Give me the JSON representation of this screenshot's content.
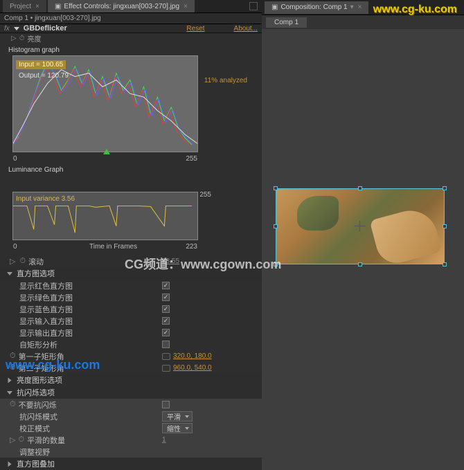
{
  "tabs": {
    "project": "Project",
    "effect_controls": "Effect Controls: jingxuan[003-270].jpg"
  },
  "breadcrumb": "Comp 1 • jingxuan[003-270].jpg",
  "effect": {
    "name": "GBDeflicker",
    "reset": "Reset",
    "about": "About...",
    "brightness": "亮度"
  },
  "histogram": {
    "title": "Histogram graph",
    "input": "Input = 100.65",
    "output": "Output = 120.79",
    "analyzed": "11% analyzed",
    "axis_left": "0",
    "axis_right": "255"
  },
  "luminance": {
    "title": "Luminance Graph",
    "variance": "Input variance 3.56",
    "axis_255": "255",
    "axis_0": "0",
    "axis_mid": "Time in Frames",
    "axis_223": "223"
  },
  "scroll": {
    "label": "滚动",
    "value": "28.55"
  },
  "groups": {
    "hist_options": "直方图选项",
    "show_red": "显示红色直方图",
    "show_green": "显示绿色直方图",
    "show_blue": "显示蓝色直方图",
    "show_input": "显示输入直方图",
    "show_output": "显示输出直方图",
    "auto_rect": "自矩形分析",
    "rect1": "第一子矩形角",
    "rect1_val": "320.0, 180.0",
    "rect2": "第二子矩形角",
    "rect2_val": "960.0, 540.0",
    "lum_graph_options": "亮度图形选项",
    "deflicker_options": "抗闪烁选项",
    "no_deflicker": "不要抗闪烁",
    "deflicker_mode": "抗闪烁模式",
    "deflicker_mode_val": "平滑",
    "correction_mode": "校正模式",
    "correction_mode_val": "缩性",
    "smooth_intensity": "平滑的数量",
    "smooth_val": "1",
    "adjust_range": "调整视野",
    "hist_overlay": "直方图叠加"
  },
  "comp": {
    "panel_title": "Composition: Comp 1",
    "tab": "Comp 1"
  },
  "watermarks": {
    "w1": "www.cg-ku.com",
    "w2": "CG频道：www.cgown.com",
    "w3": "www.cg-ku.com"
  }
}
